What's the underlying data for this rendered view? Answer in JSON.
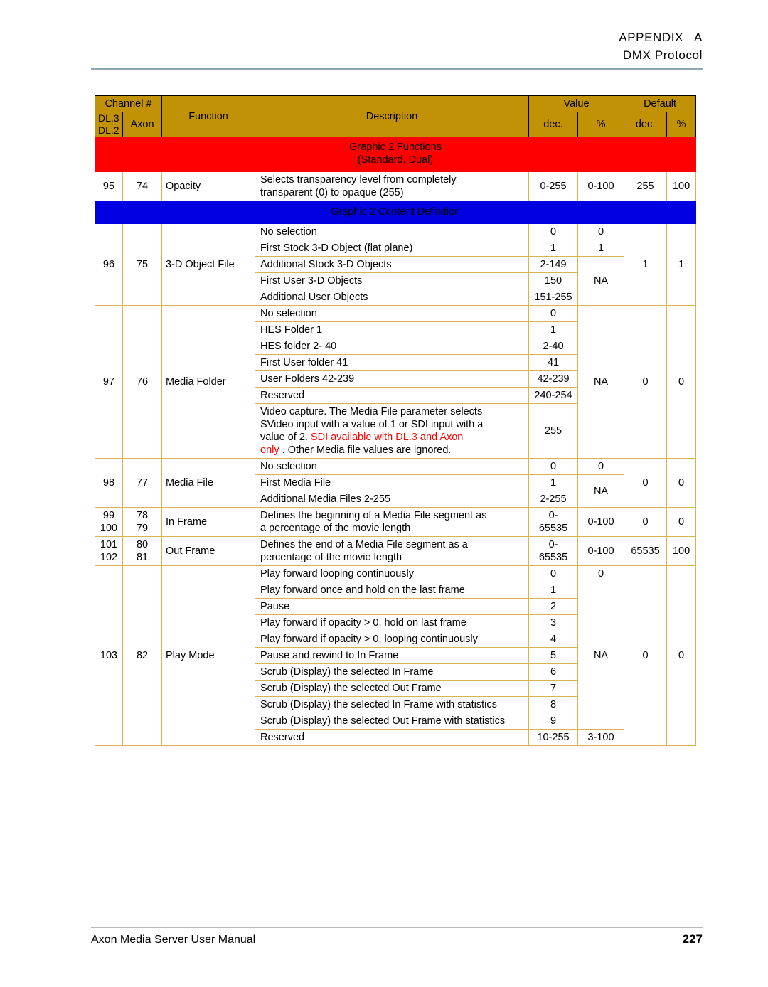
{
  "header": {
    "line1": "APPENDIX   A",
    "line2": "DMX Protocol"
  },
  "table": {
    "columns": {
      "channel_group": "Channel #",
      "dl3": "DL.3",
      "dl2": "DL.2",
      "axon": "Axon",
      "function": "Function",
      "description": "Description",
      "value_group": "Value",
      "default_group": "Default",
      "value_dec": "dec.",
      "value_pct": "%",
      "default_dec": "dec.",
      "default_pct": "%"
    },
    "banners": {
      "graphic2_functions_line1": "Graphic 2 Functions",
      "graphic2_functions_line2": "(Standard, Dual)",
      "graphic2_content_definition": "Graphic 2 Content Definition"
    },
    "rows": {
      "opacity": {
        "dl": "95",
        "axon": "74",
        "function": "Opacity",
        "description_line1": "Selects transparency level from completely",
        "description_line2": "transparent (0) to opaque (255)",
        "value_dec": "0-255",
        "value_pct": "0-100",
        "default_dec": "255",
        "default_pct": "100"
      },
      "object3d": {
        "dl": "96",
        "axon": "75",
        "function": "3-D Object File",
        "default_dec": "1",
        "default_pct": "1",
        "value_pct_na": "NA",
        "items": [
          {
            "description": "No selection",
            "value_dec": "0",
            "value_pct": "0"
          },
          {
            "description": "First Stock 3-D Object (flat plane)",
            "value_dec": "1",
            "value_pct": "1"
          },
          {
            "description": "Additional Stock 3-D Objects",
            "value_dec": "2-149"
          },
          {
            "description": "First User 3-D Objects",
            "value_dec": "150"
          },
          {
            "description": "Additional User Objects",
            "value_dec": "151-255"
          }
        ]
      },
      "media_folder": {
        "dl": "97",
        "axon": "76",
        "function": "Media Folder",
        "value_pct_na": "NA",
        "default_dec": "0",
        "default_pct": "0",
        "items": [
          {
            "description": "No selection",
            "value_dec": "0"
          },
          {
            "description": "HES Folder 1",
            "value_dec": "1"
          },
          {
            "description": "HES folder 2- 40",
            "value_dec": "2-40"
          },
          {
            "description": "First User folder 41",
            "value_dec": "41"
          },
          {
            "description": "User Folders 42-239",
            "value_dec": "42-239"
          },
          {
            "description": "Reserved",
            "value_dec": "240-254"
          }
        ],
        "video_capture": {
          "line1": "Video capture. The Media File parameter selects",
          "line2": "SVideo input with a value of 1 or SDI input with a",
          "line3_black": "value of 2.",
          "line3_red": " SDI available with DL.3 and Axon",
          "line4_red": "only",
          "line4_black": " . Other Media file values are ignored.",
          "value_dec": "255"
        }
      },
      "media_file": {
        "dl": "98",
        "axon": "77",
        "function": "Media File",
        "value_pct_na": "NA",
        "default_dec": "0",
        "default_pct": "0",
        "items": [
          {
            "description": "No selection",
            "value_dec": "0",
            "value_pct": "0"
          },
          {
            "description": "First Media File",
            "value_dec": "1"
          },
          {
            "description": "Additional Media Files 2-255",
            "value_dec": "2-255"
          }
        ]
      },
      "in_frame": {
        "dl_line1": "99",
        "dl_line2": "100",
        "axon_line1": "78",
        "axon_line2": "79",
        "function": "In Frame",
        "description_line1": "Defines the beginning of a Media File segment as",
        "description_line2": "a percentage of the movie length",
        "value_dec_line1": "0-",
        "value_dec_line2": "65535",
        "value_pct": "0-100",
        "default_dec": "0",
        "default_pct": "0"
      },
      "out_frame": {
        "dl_line1": "101",
        "dl_line2": "102",
        "axon_line1": "80",
        "axon_line2": "81",
        "function": "Out Frame",
        "description_line1": "Defines the end of a Media File segment as a",
        "description_line2": "percentage of the movie length",
        "value_dec_line1": "0-",
        "value_dec_line2": "65535",
        "value_pct": "0-100",
        "default_dec": "65535",
        "default_pct": "100"
      },
      "play_mode": {
        "dl": "103",
        "axon": "82",
        "function": "Play Mode",
        "value_pct_na": "NA",
        "default_dec": "0",
        "default_pct": "0",
        "items": [
          {
            "description": "Play forward looping continuously",
            "value_dec": "0",
            "value_pct": "0"
          },
          {
            "description": "Play forward once and hold on the last frame",
            "value_dec": "1"
          },
          {
            "description": "Pause",
            "value_dec": "2"
          },
          {
            "description": "Play forward if opacity > 0, hold on last frame",
            "value_dec": "3"
          },
          {
            "description": "Play forward if opacity > 0, looping continuously",
            "value_dec": "4"
          },
          {
            "description": "Pause and rewind to In Frame",
            "value_dec": "5"
          },
          {
            "description": "Scrub (Display) the selected In Frame",
            "value_dec": "6"
          },
          {
            "description": "Scrub (Display) the selected Out Frame",
            "value_dec": "7"
          },
          {
            "description": "Scrub (Display) the selected In Frame with statistics",
            "value_dec": "8"
          },
          {
            "description": "Scrub (Display) the selected Out Frame with statistics",
            "value_dec": "9"
          },
          {
            "description": "Reserved",
            "value_dec": "10-255",
            "value_pct": "3-100"
          }
        ]
      }
    }
  },
  "footer": {
    "manual_title": "Axon Media Server User Manual",
    "page_number": "227"
  }
}
